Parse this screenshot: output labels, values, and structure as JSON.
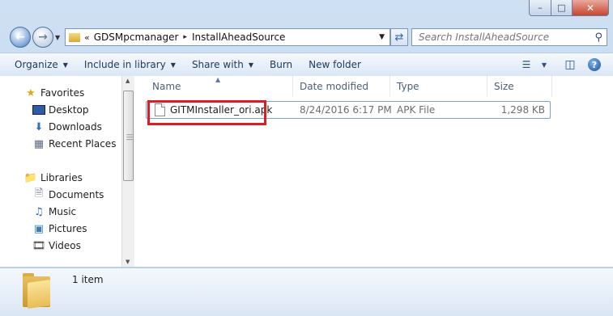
{
  "window": {
    "minimize_glyph": "–",
    "maximize_glyph": "□",
    "close_glyph": "✕"
  },
  "address_bar": {
    "overflow": "«",
    "crumbs": [
      "GDSMpcmanager",
      "InstallAheadSource"
    ],
    "separator": "▸"
  },
  "search": {
    "placeholder": "Search InstallAheadSource"
  },
  "toolbar": {
    "organize": "Organize",
    "include_in_library": "Include in library",
    "share_with": "Share with",
    "burn": "Burn",
    "new_folder": "New folder"
  },
  "nav_pane": {
    "favorites": "Favorites",
    "desktop": "Desktop",
    "downloads": "Downloads",
    "recent_places": "Recent Places",
    "libraries": "Libraries",
    "documents": "Documents",
    "music": "Music",
    "pictures": "Pictures",
    "videos": "Videos"
  },
  "columns": {
    "name": "Name",
    "date_modified": "Date modified",
    "type": "Type",
    "size": "Size"
  },
  "files": [
    {
      "name": "GITMInstaller_ori.apk",
      "date_modified": "8/24/2016 6:17 PM",
      "type": "APK File",
      "size": "1,298 KB"
    }
  ],
  "details": {
    "item_count": "1 item"
  },
  "colors": {
    "highlight_box": "#d91e2a",
    "selection_border": "#7da2ce"
  }
}
